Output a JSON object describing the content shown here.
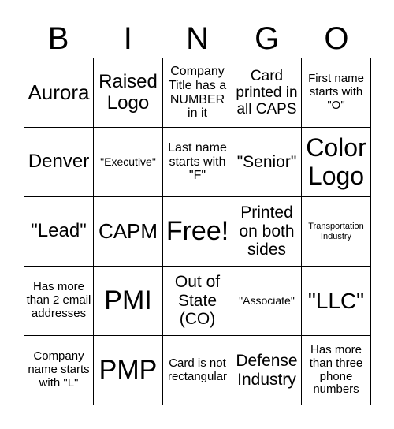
{
  "header": [
    "B",
    "I",
    "N",
    "G",
    "O"
  ],
  "cells": [
    "Aurora",
    "Raised Logo",
    "Company Title has a NUMBER in it",
    "Card printed in all CAPS",
    "First name starts with \"O\"",
    "Denver",
    "\"Executive\"",
    "Last name starts with \"F\"",
    "\"Senior\"",
    "Color Logo",
    "\"Lead\"",
    "CAPM",
    "Free!",
    "Printed on both sides",
    "Transportation Industry",
    "Has more than 2 email addresses",
    "PMI",
    "Out of State (CO)",
    "\"Associate\"",
    "\"LLC\"",
    "Company name starts with \"L\"",
    "PMP",
    "Card is not rectangular",
    "Defense Industry",
    "Has more than three phone numbers"
  ]
}
